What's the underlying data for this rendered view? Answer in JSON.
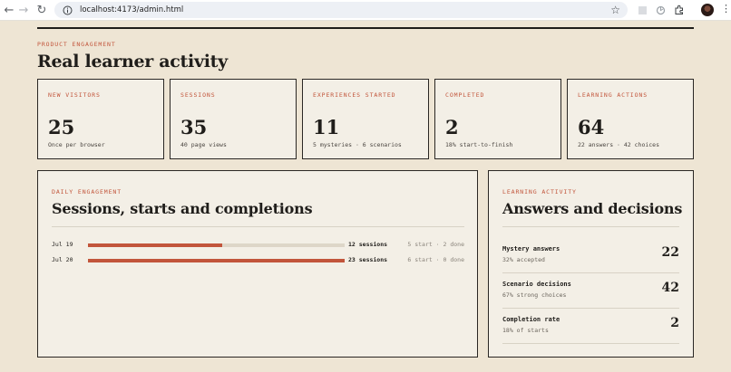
{
  "browser": {
    "url": "localhost:4173/admin.html"
  },
  "page": {
    "eyebrow": "PRODUCT ENGAGEMENT",
    "title": "Real learner activity"
  },
  "cards": [
    {
      "label": "NEW VISITORS",
      "value": "25",
      "note": "Once per browser"
    },
    {
      "label": "SESSIONS",
      "value": "35",
      "note": "40 page views"
    },
    {
      "label": "EXPERIENCES STARTED",
      "value": "11",
      "note": "5 mysteries · 6 scenarios"
    },
    {
      "label": "COMPLETED",
      "value": "2",
      "note": "18% start-to-finish"
    },
    {
      "label": "LEARNING ACTIONS",
      "value": "64",
      "note": "22 answers · 42 choices"
    }
  ],
  "daily": {
    "eyebrow": "DAILY ENGAGEMENT",
    "title": "Sessions, starts and completions",
    "rows": [
      {
        "date": "Jul 19",
        "sessions": 12,
        "count_label": "12 sessions",
        "meta": "5 start · 2 done"
      },
      {
        "date": "Jul 20",
        "sessions": 23,
        "count_label": "23 sessions",
        "meta": "6 start · 0 done"
      }
    ]
  },
  "learning": {
    "eyebrow": "LEARNING ACTIVITY",
    "title": "Answers and decisions",
    "rows": [
      {
        "label": "Mystery answers",
        "note": "32% accepted",
        "value": "22"
      },
      {
        "label": "Scenario decisions",
        "note": "67% strong choices",
        "value": "42"
      },
      {
        "label": "Completion rate",
        "note": "18% of starts",
        "value": "2"
      }
    ]
  },
  "colors": {
    "accent": "#c2553b",
    "background": "#eee5d4",
    "ink": "#1f1d1a"
  }
}
